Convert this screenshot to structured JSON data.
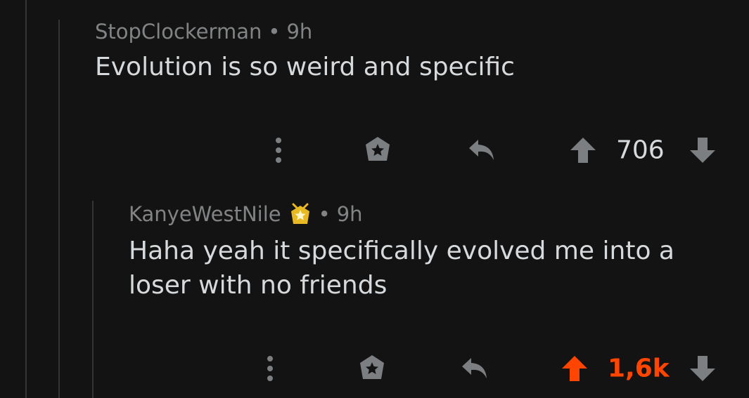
{
  "comments": [
    {
      "username": "StopClockerman",
      "separator": "•",
      "time": "9h",
      "body": "Evolution is so weird and specific",
      "score": "706",
      "voted": false
    },
    {
      "username": "KanyeWestNile",
      "separator": "•",
      "time": "9h",
      "body": "Haha yeah it specifically evolved me into a loser with no friends",
      "score": "1,6k",
      "voted": true,
      "award_icon": "gold-award-icon"
    }
  ],
  "colors": {
    "background": "#131313",
    "text": "#d7dadc",
    "meta": "#818384",
    "icon": "#7c7f82",
    "upvote": "#ff4500",
    "thread_line": "#343536",
    "award_gold": "#e8b923"
  }
}
